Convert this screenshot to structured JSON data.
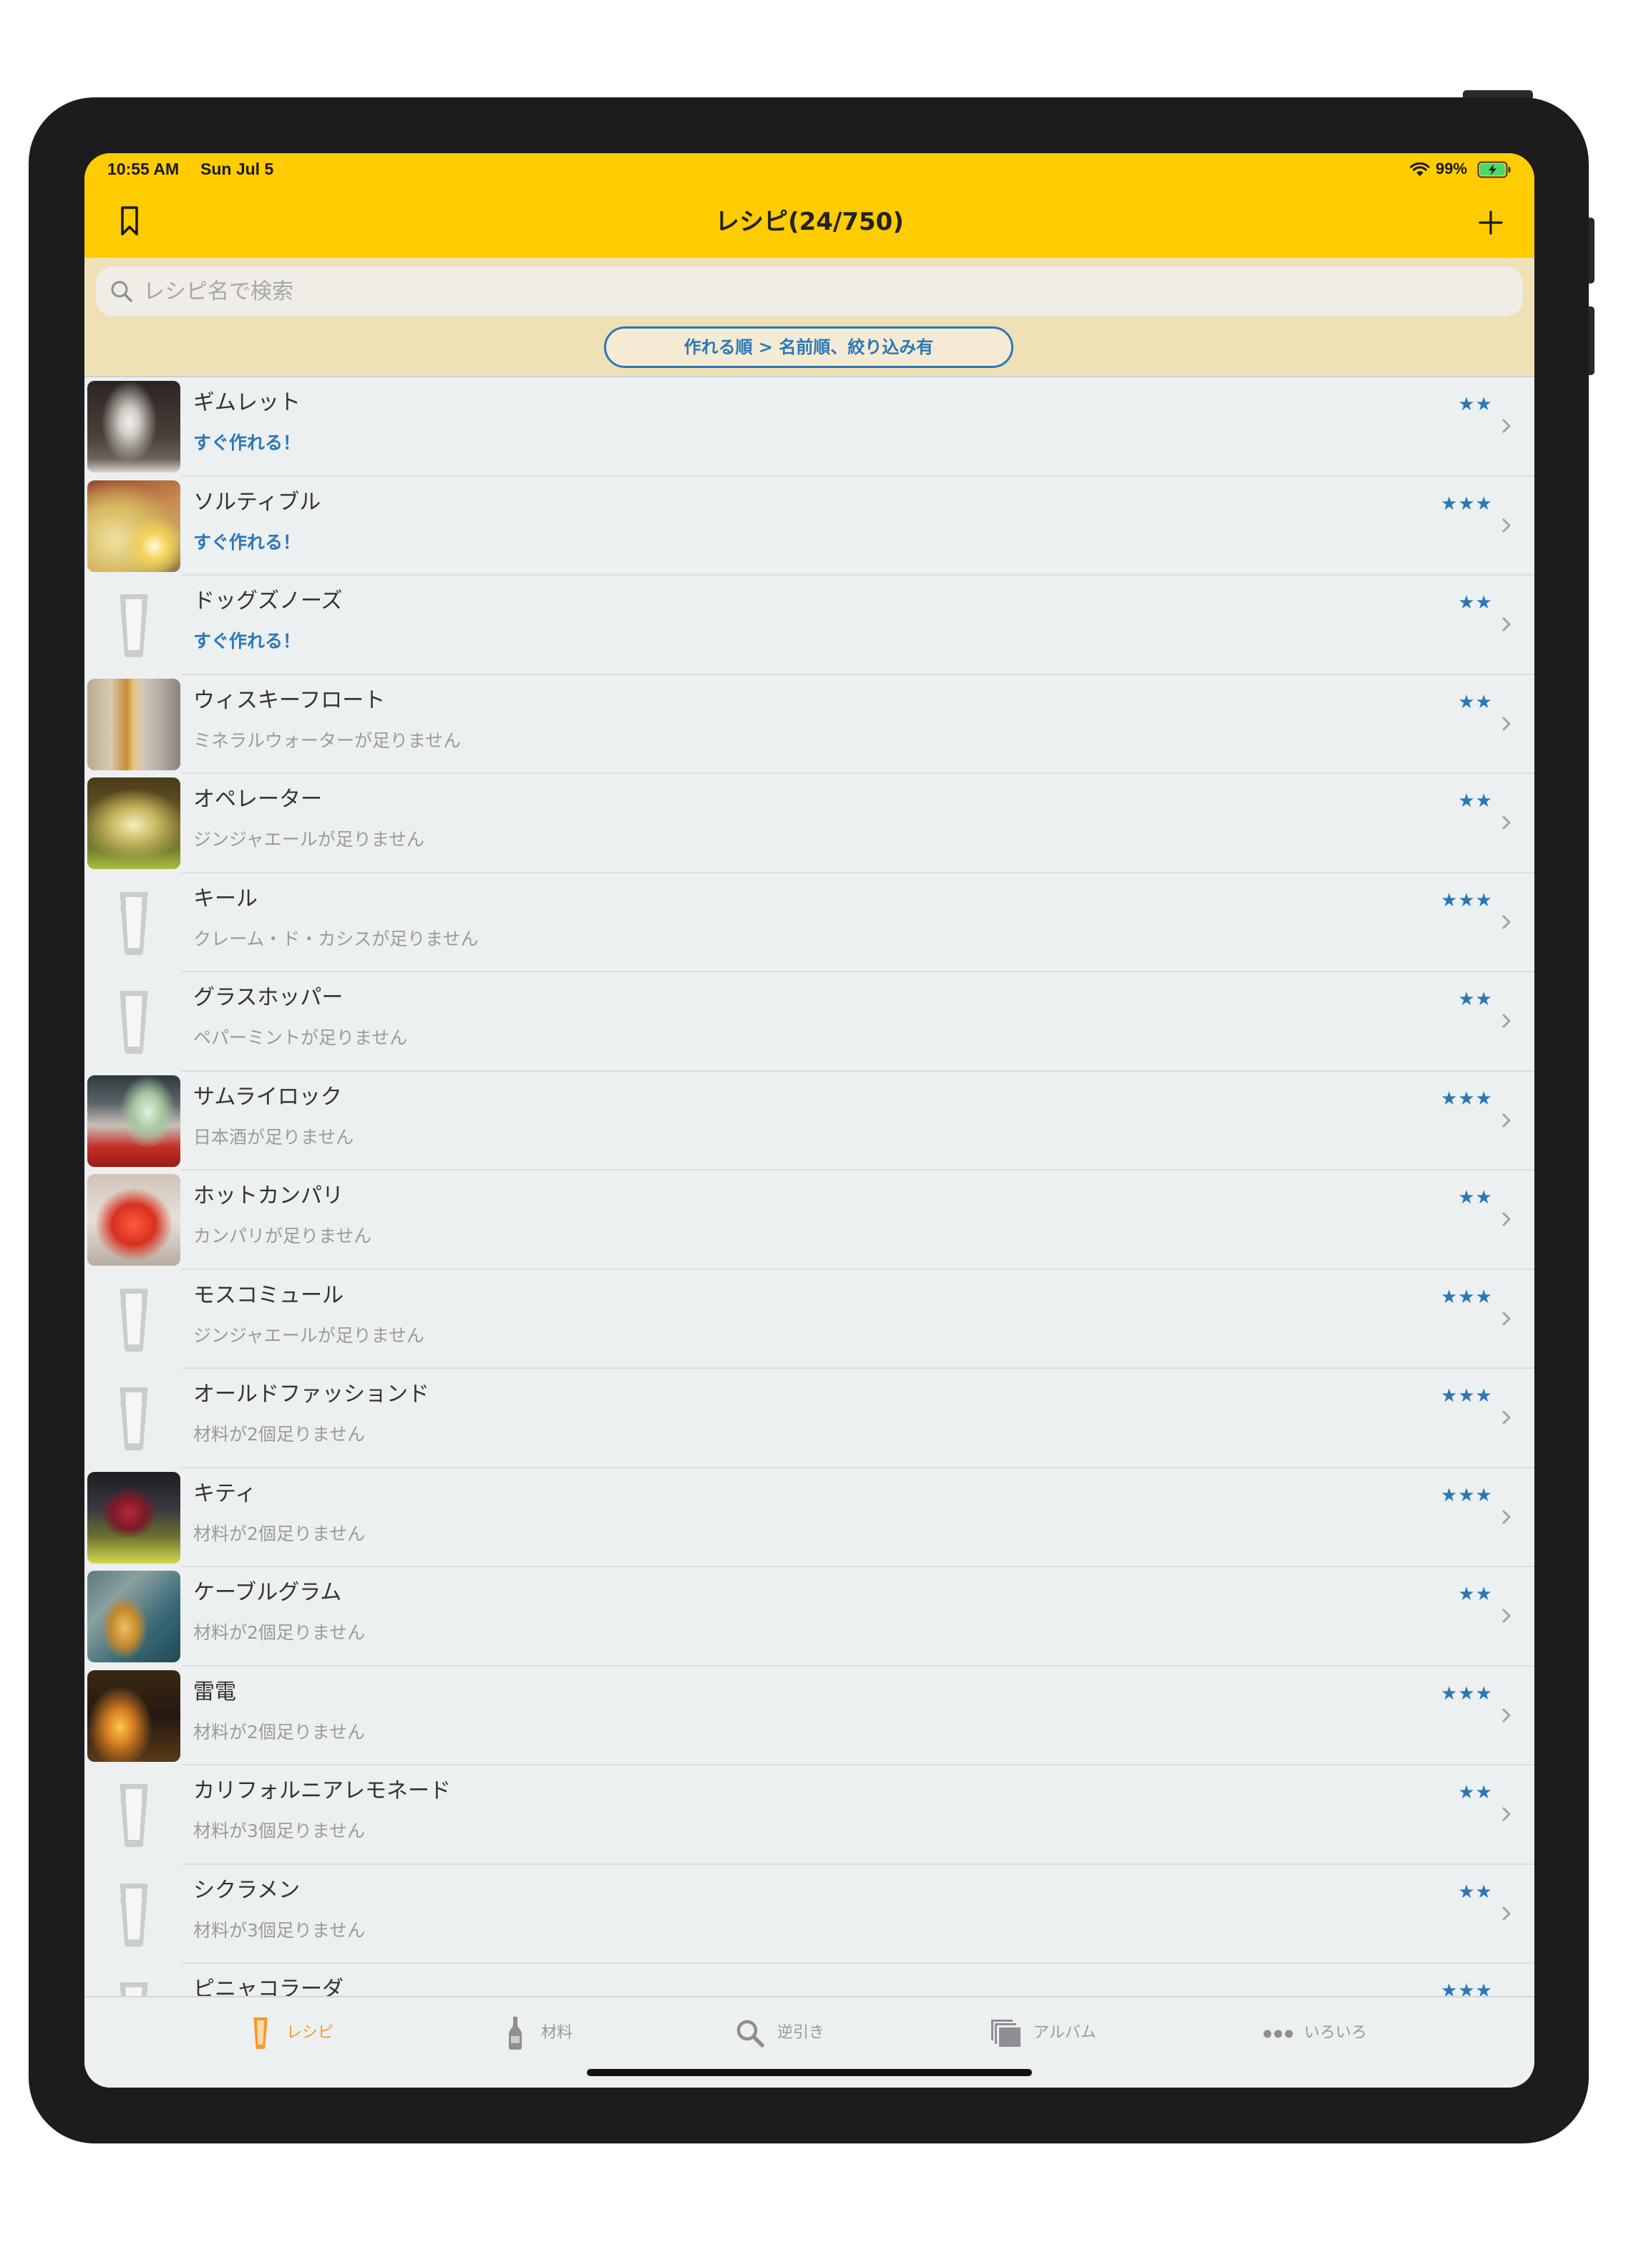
{
  "status_bar": {
    "time": "10:55 AM",
    "date": "Sun Jul 5",
    "battery_percent_text": "99%",
    "battery_level": 0.99,
    "charging": true,
    "wifi_icon": "wifi-icon",
    "battery_icon": "battery-charging-icon"
  },
  "nav": {
    "title": "レシピ(24/750)",
    "left_icon": "bookmark-icon",
    "right_icon": "plus-icon"
  },
  "search": {
    "placeholder": "レシピ名で検索",
    "value": "",
    "icon": "search-icon"
  },
  "sort_button": {
    "label": "作れる順 > 名前順、絞り込み有"
  },
  "recipes": [
    {
      "title": "ギムレット",
      "rating": 2,
      "status": "すぐ作れる！",
      "ready": true,
      "thumbnail": "photo"
    },
    {
      "title": "ソルティブル",
      "rating": 3,
      "status": "すぐ作れる！",
      "ready": true,
      "thumbnail": "photo"
    },
    {
      "title": "ドッグズノーズ",
      "rating": 2,
      "status": "すぐ作れる！",
      "ready": true,
      "thumbnail": "glass-placeholder-icon"
    },
    {
      "title": "ウィスキーフロート",
      "rating": 2,
      "status": "ミネラルウォーターが足りません",
      "ready": false,
      "thumbnail": "photo"
    },
    {
      "title": "オペレーター",
      "rating": 2,
      "status": "ジンジャエールが足りません",
      "ready": false,
      "thumbnail": "photo"
    },
    {
      "title": "キール",
      "rating": 3,
      "status": "クレーム・ド・カシスが足りません",
      "ready": false,
      "thumbnail": "glass-placeholder-icon"
    },
    {
      "title": "グラスホッパー",
      "rating": 2,
      "status": "ペパーミントが足りません",
      "ready": false,
      "thumbnail": "glass-placeholder-icon"
    },
    {
      "title": "サムライロック",
      "rating": 3,
      "status": "日本酒が足りません",
      "ready": false,
      "thumbnail": "photo"
    },
    {
      "title": "ホットカンパリ",
      "rating": 2,
      "status": "カンパリが足りません",
      "ready": false,
      "thumbnail": "photo"
    },
    {
      "title": "モスコミュール",
      "rating": 3,
      "status": "ジンジャエールが足りません",
      "ready": false,
      "thumbnail": "glass-placeholder-icon"
    },
    {
      "title": "オールドファッションド",
      "rating": 3,
      "status": "材料が2個足りません",
      "ready": false,
      "thumbnail": "glass-placeholder-icon"
    },
    {
      "title": "キティ",
      "rating": 3,
      "status": "材料が2個足りません",
      "ready": false,
      "thumbnail": "photo"
    },
    {
      "title": "ケーブルグラム",
      "rating": 2,
      "status": "材料が2個足りません",
      "ready": false,
      "thumbnail": "photo"
    },
    {
      "title": "雷電",
      "rating": 3,
      "status": "材料が2個足りません",
      "ready": false,
      "thumbnail": "photo"
    },
    {
      "title": "カリフォルニアレモネード",
      "rating": 2,
      "status": "材料が3個足りません",
      "ready": false,
      "thumbnail": "glass-placeholder-icon"
    },
    {
      "title": "シクラメン",
      "rating": 2,
      "status": "材料が3個足りません",
      "ready": false,
      "thumbnail": "glass-placeholder-icon"
    },
    {
      "title": "ピニャコラーダ",
      "rating": 3,
      "ready": false,
      "thumbnail": "glass-placeholder-icon"
    }
  ],
  "tab_bar": {
    "items": [
      {
        "label": "レシピ",
        "icon": "glass-icon",
        "active": true
      },
      {
        "label": "材料",
        "icon": "bottle-icon",
        "active": false
      },
      {
        "label": "逆引き",
        "icon": "search-icon",
        "active": false
      },
      {
        "label": "アルバム",
        "icon": "album-icon",
        "active": false
      },
      {
        "label": "いろいろ",
        "icon": "more-dots-icon",
        "active": false
      }
    ]
  },
  "colors": {
    "nav_bar": "#FFCC00",
    "search_area": "#F0E0B6",
    "list_background": "#ECF0F1",
    "accent_blue": "#2B78B8",
    "active_tab": "#F39C2F",
    "inactive_tab": "#9A9A9E",
    "subtitle_gray": "#9B9B9B",
    "battery_green": "#4CD964"
  }
}
